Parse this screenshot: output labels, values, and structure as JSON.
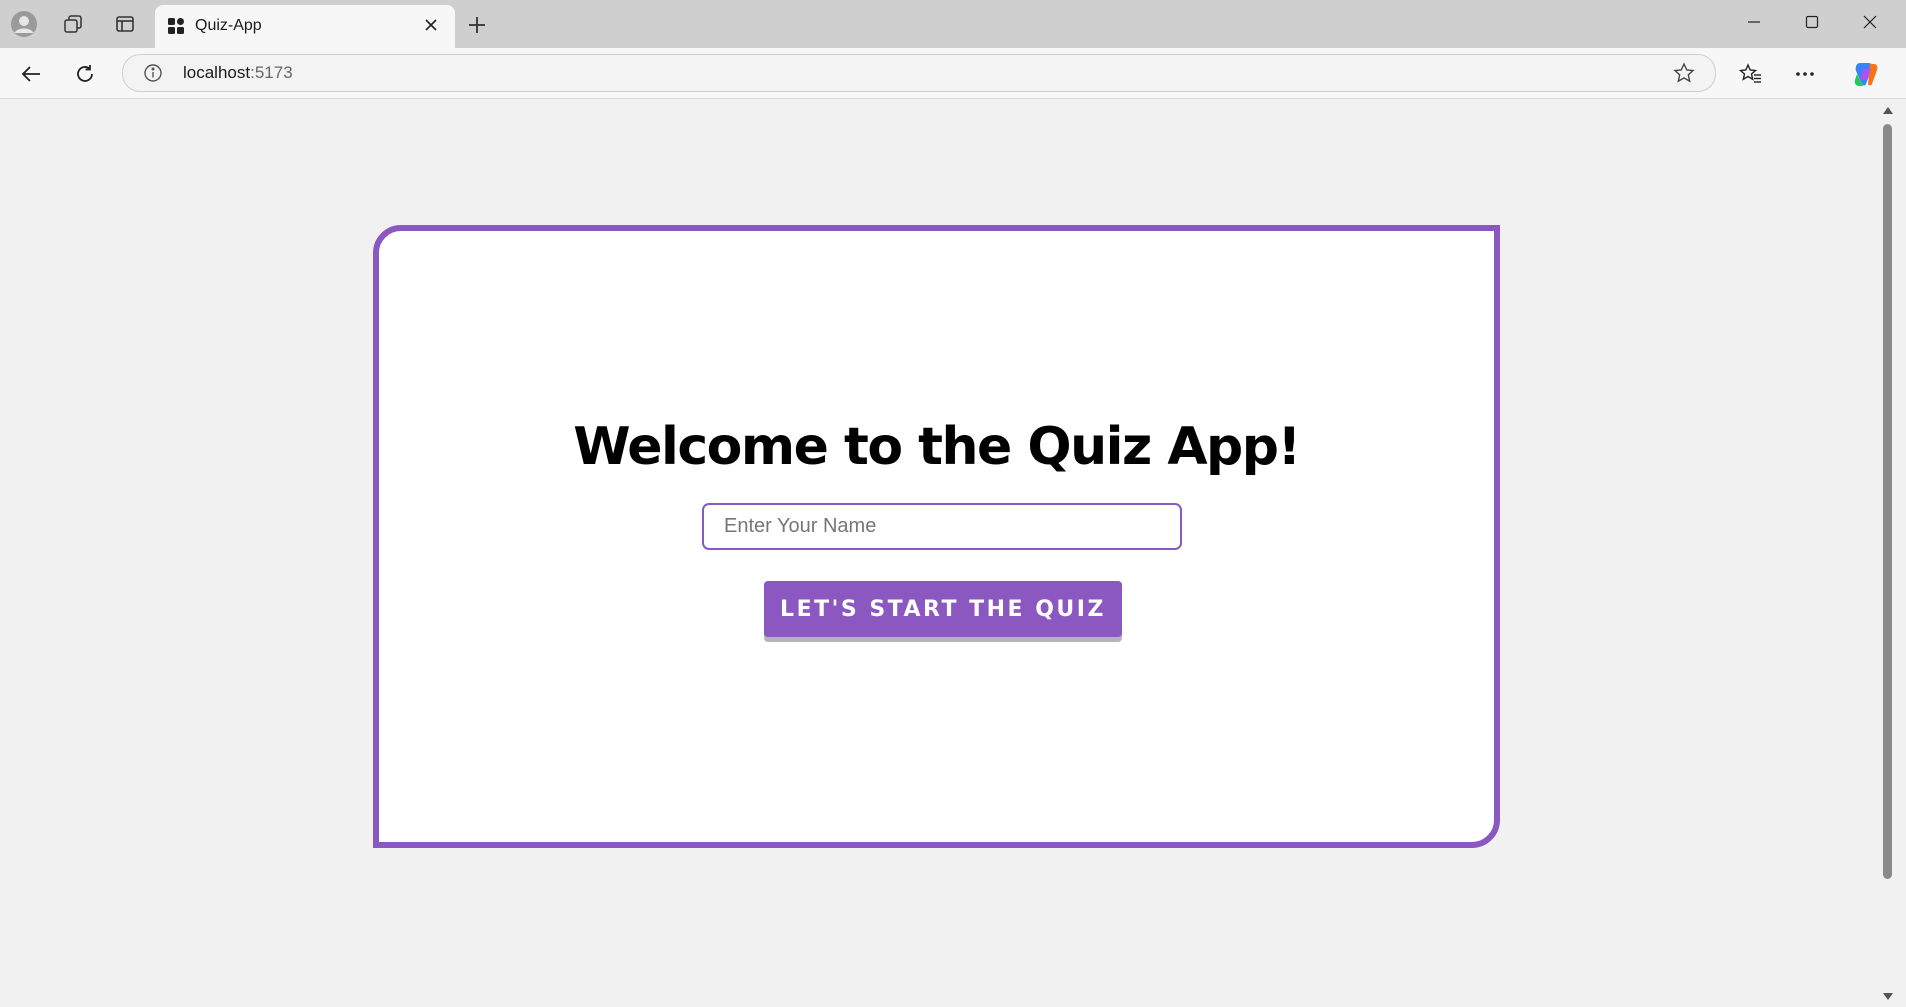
{
  "browser": {
    "tab": {
      "title": "Quiz-App",
      "favicon": "grid-app-icon"
    },
    "address": {
      "host": "localhost",
      "port": ":5173"
    },
    "icons": [
      "profile-icon",
      "workspaces-icon",
      "tab-actions-icon",
      "close-icon",
      "plus-icon",
      "minimize-icon",
      "maximize-icon",
      "window-close-icon",
      "back-arrow-icon",
      "refresh-icon",
      "info-icon",
      "star-icon",
      "favorites-icon",
      "more-icon",
      "copilot-icon"
    ]
  },
  "quiz": {
    "heading": "Welcome to the Quiz App!",
    "name_input": {
      "placeholder": "Enter Your Name",
      "value": ""
    },
    "start_button": "Let's Start the Quiz"
  },
  "colors": {
    "accent": "#8b57c0",
    "page_background": "#f1f1f1",
    "card_background": "#ffffff"
  }
}
